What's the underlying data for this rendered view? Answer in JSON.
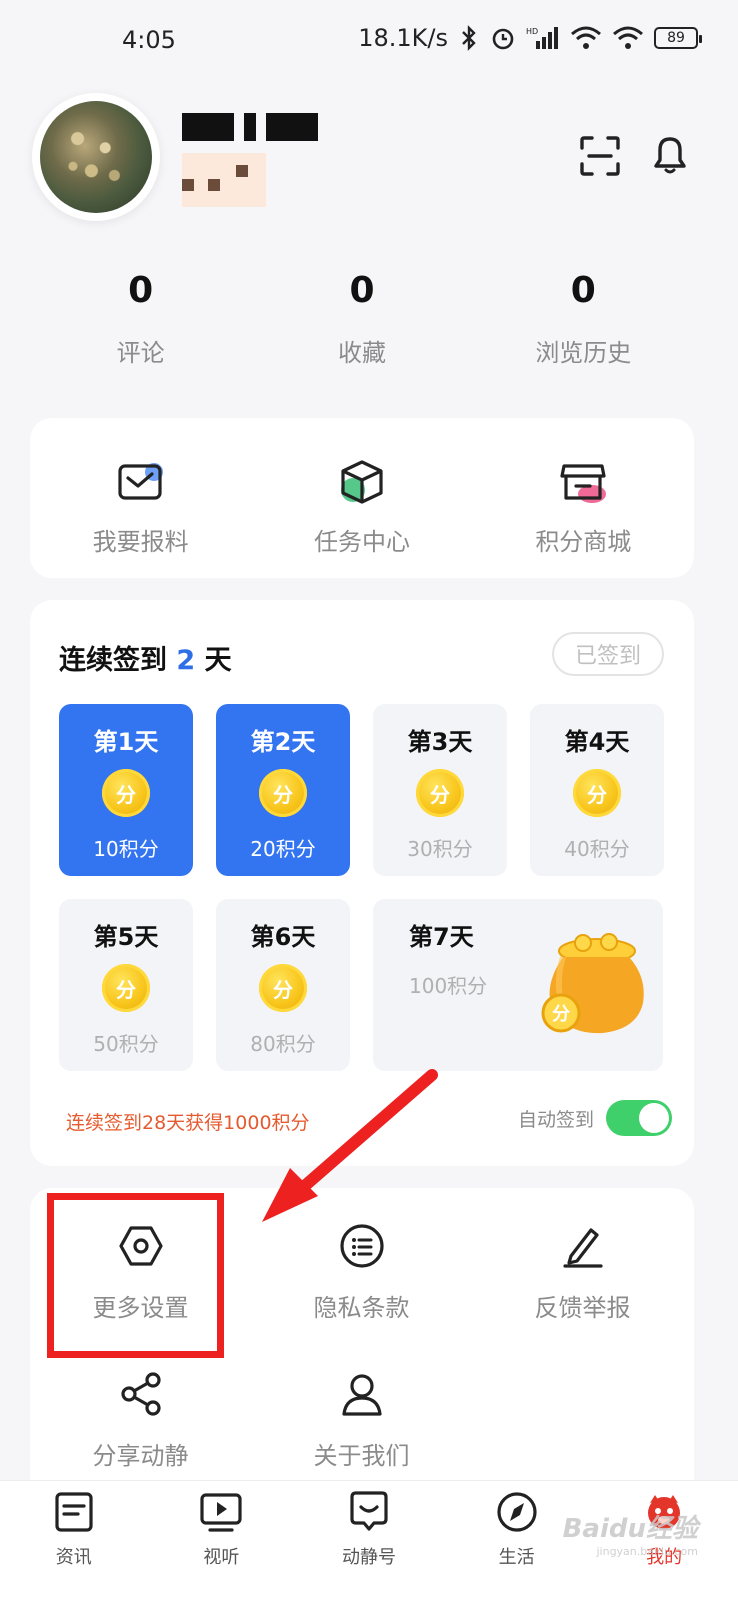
{
  "status_bar": {
    "time": "4:05",
    "net_speed": "18.1K/s",
    "battery": "89"
  },
  "stats": [
    {
      "value": "0",
      "label": "评论"
    },
    {
      "value": "0",
      "label": "收藏"
    },
    {
      "value": "0",
      "label": "浏览历史"
    }
  ],
  "quick_actions": [
    {
      "label": "我要报料",
      "icon": "envelope-icon"
    },
    {
      "label": "任务中心",
      "icon": "box-icon"
    },
    {
      "label": "积分商城",
      "icon": "store-icon"
    }
  ],
  "signin": {
    "title_prefix": "连续签到",
    "days": "2",
    "title_suffix": "天",
    "signed_label": "已签到",
    "coin_label": "分",
    "day_cards": [
      {
        "name": "第1天",
        "points": "10积分",
        "done": true
      },
      {
        "name": "第2天",
        "points": "20积分",
        "done": true
      },
      {
        "name": "第3天",
        "points": "30积分",
        "done": false
      },
      {
        "name": "第4天",
        "points": "40积分",
        "done": false
      },
      {
        "name": "第5天",
        "points": "50积分",
        "done": false
      },
      {
        "name": "第6天",
        "points": "80积分",
        "done": false
      },
      {
        "name": "第7天",
        "points": "100积分",
        "done": false
      }
    ],
    "streak_note": "连续签到28天获得1000积分",
    "auto_label": "自动签到",
    "auto_enabled": true
  },
  "more_items": [
    {
      "label": "更多设置",
      "icon": "hexagon-settings-icon"
    },
    {
      "label": "隐私条款",
      "icon": "list-circle-icon"
    },
    {
      "label": "反馈举报",
      "icon": "pen-icon"
    },
    {
      "label": "分享动静",
      "icon": "share-icon"
    },
    {
      "label": "关于我们",
      "icon": "person-icon"
    }
  ],
  "nav": [
    {
      "label": "资讯",
      "icon": "news-icon"
    },
    {
      "label": "视听",
      "icon": "tv-icon"
    },
    {
      "label": "动静号",
      "icon": "chat-icon"
    },
    {
      "label": "生活",
      "icon": "compass-icon"
    },
    {
      "label": "我的",
      "icon": "mascot-icon",
      "active": true
    }
  ],
  "watermark": {
    "brand": "Baidu经验",
    "url": "jingyan.baidu.com"
  },
  "colors": {
    "accent": "#3374f0",
    "highlight": "#ee2121",
    "streak": "#e55b2f",
    "toggle": "#3fcf6b"
  }
}
